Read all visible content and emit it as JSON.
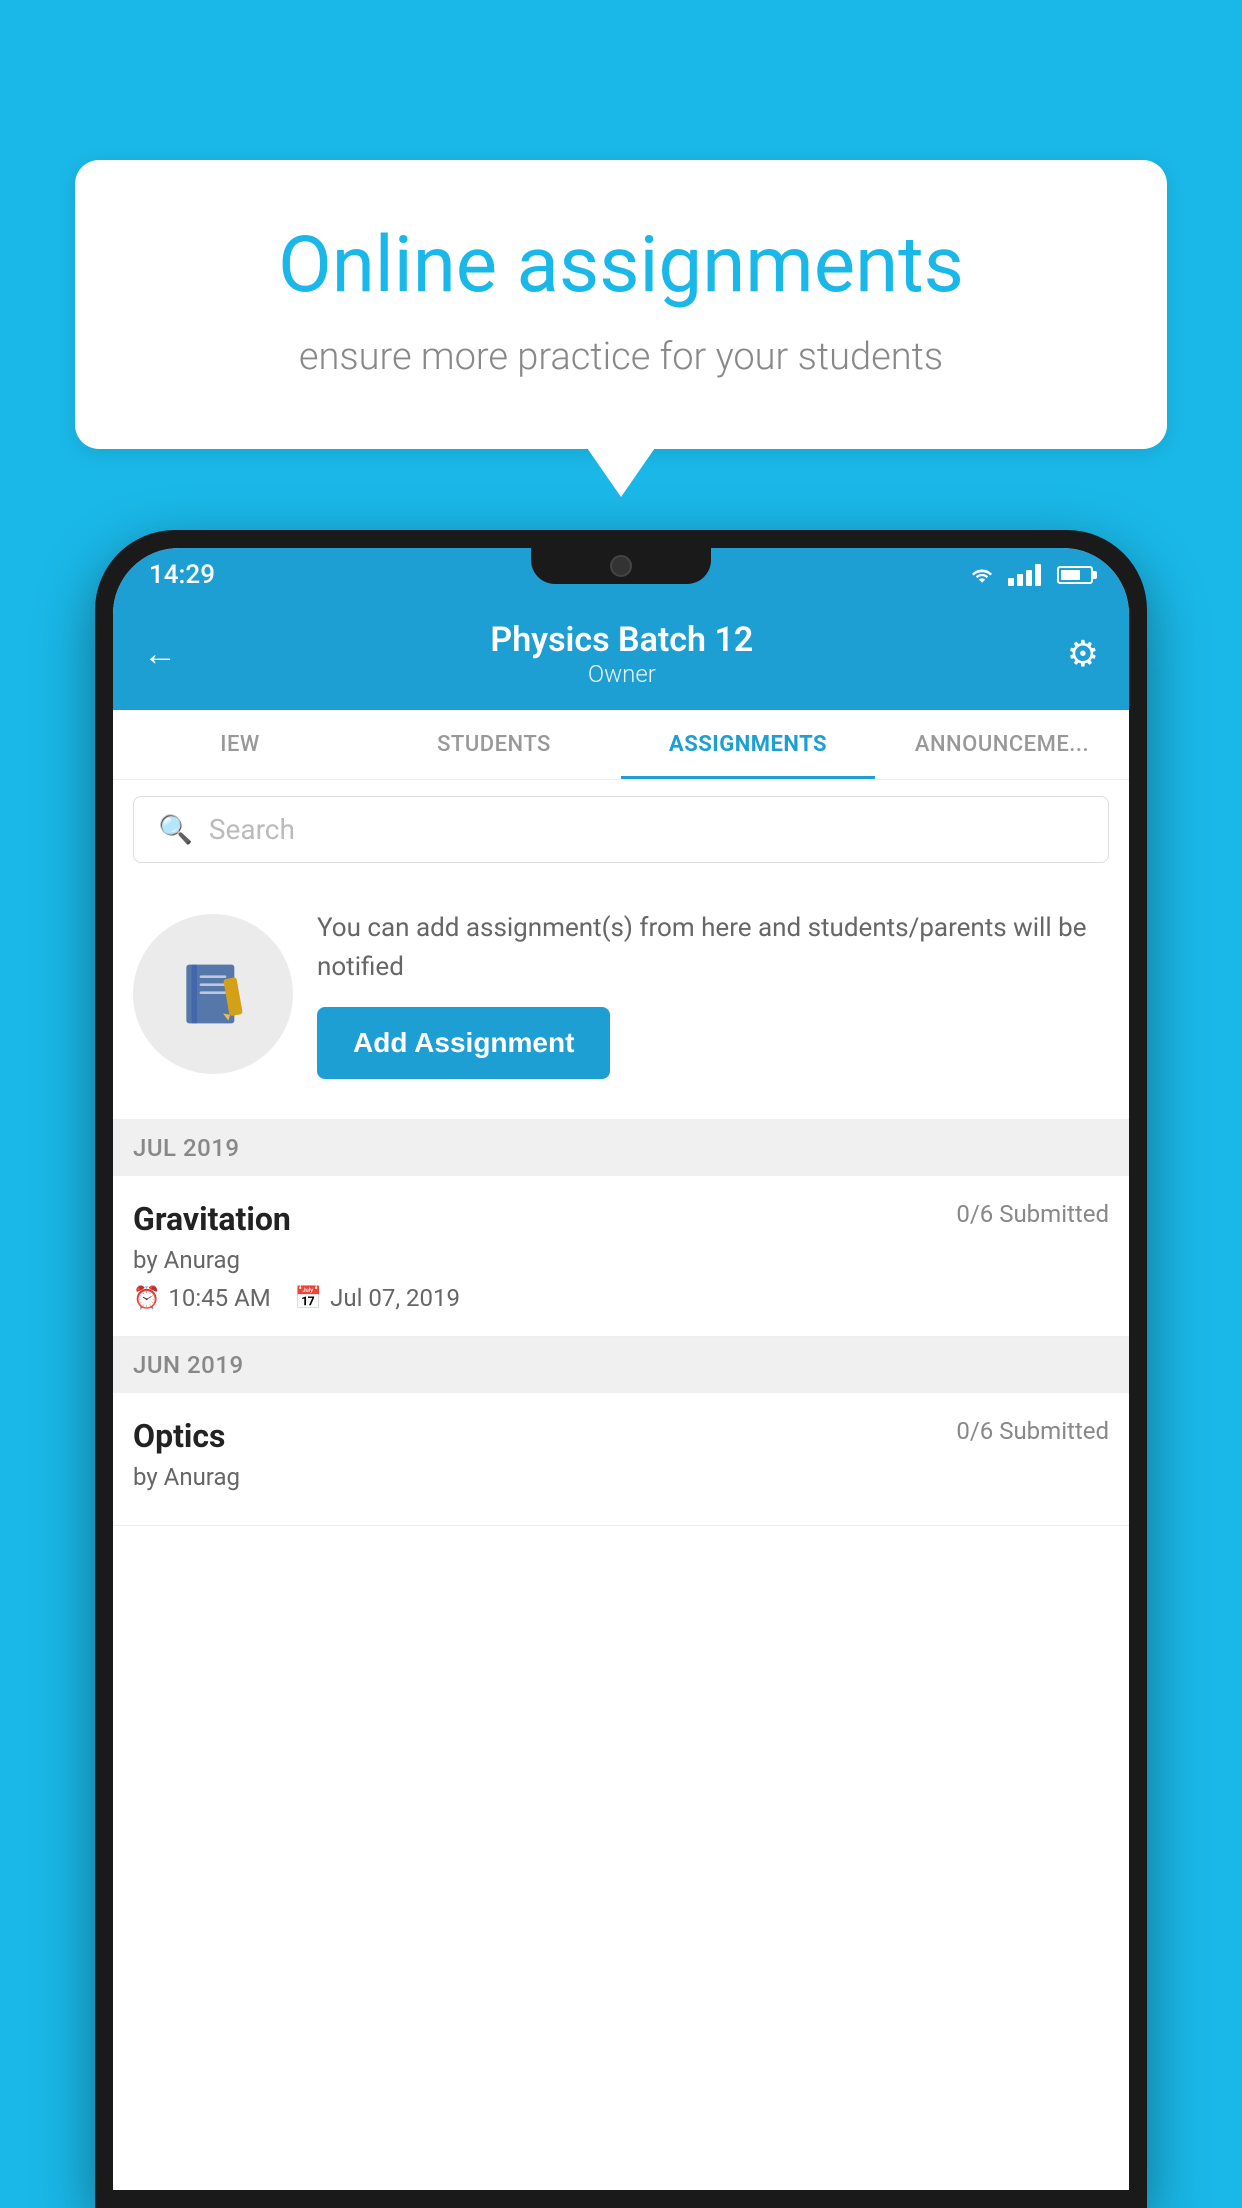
{
  "background_color": "#1ab8e8",
  "speech_bubble": {
    "title": "Online assignments",
    "subtitle": "ensure more practice for your students"
  },
  "phone": {
    "status_bar": {
      "time": "14:29"
    },
    "header": {
      "batch_name": "Physics Batch 12",
      "owner_label": "Owner",
      "back_label": "←",
      "settings_label": "⚙"
    },
    "tabs": [
      {
        "label": "IEW",
        "active": false
      },
      {
        "label": "STUDENTS",
        "active": false
      },
      {
        "label": "ASSIGNMENTS",
        "active": true
      },
      {
        "label": "ANNOUNCEMENTS",
        "active": false
      }
    ],
    "search": {
      "placeholder": "Search"
    },
    "promo": {
      "description": "You can add assignment(s) from here and students/parents will be notified",
      "button_label": "Add Assignment"
    },
    "months": [
      {
        "label": "JUL 2019",
        "assignments": [
          {
            "title": "Gravitation",
            "submitted": "0/6 Submitted",
            "author": "by Anurag",
            "time": "10:45 AM",
            "date": "Jul 07, 2019"
          }
        ]
      },
      {
        "label": "JUN 2019",
        "assignments": [
          {
            "title": "Optics",
            "submitted": "0/6 Submitted",
            "author": "by Anurag",
            "time": "",
            "date": ""
          }
        ]
      }
    ]
  }
}
